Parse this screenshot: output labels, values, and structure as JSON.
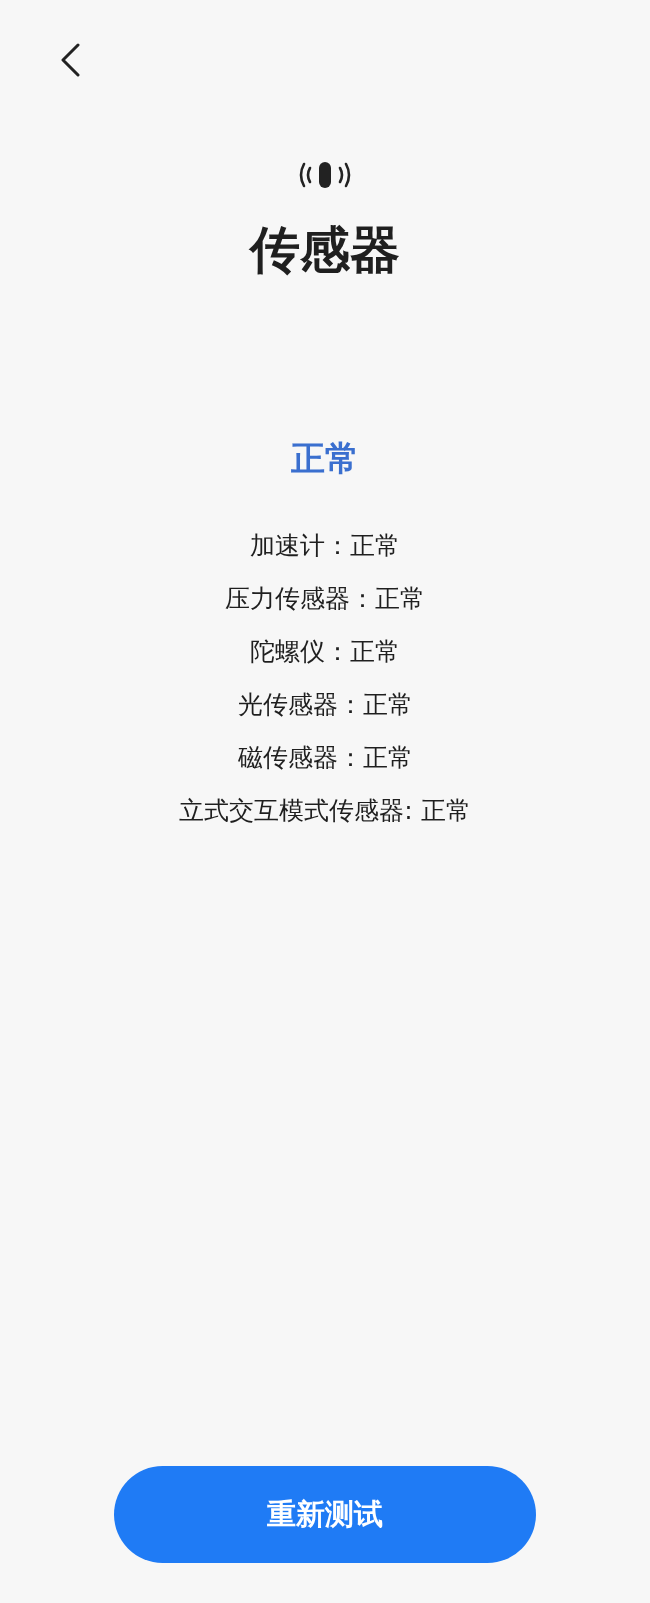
{
  "title": "传感器",
  "overall_status": "正常",
  "results": [
    "加速计：正常",
    "压力传感器：正常",
    "陀螺仪：正常",
    "光传感器：正常",
    "磁传感器：正常",
    "立式交互模式传感器: 正常"
  ],
  "button": "重新测试"
}
